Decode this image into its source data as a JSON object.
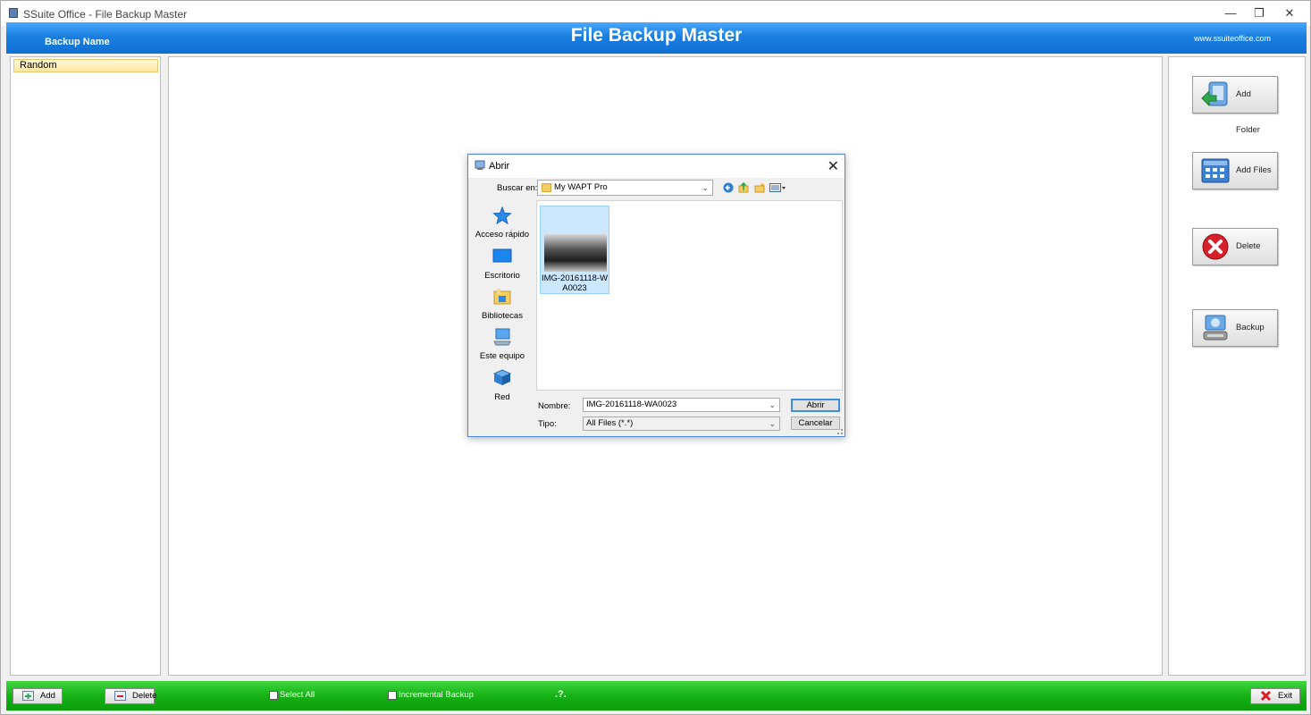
{
  "window": {
    "title": "SSuite Office - File Backup Master",
    "minimize_glyph": "—",
    "restore_glyph": "❐",
    "close_glyph": "✕"
  },
  "header": {
    "backup_name_label": "Backup Name",
    "app_title": "File Backup Master",
    "website": "www.ssuiteoffice.com",
    "color": "#1a7fe0"
  },
  "backup_list": {
    "items": [
      {
        "label": "Random",
        "selected": true
      }
    ]
  },
  "side_buttons": {
    "add_folder": {
      "label": "Add Folder",
      "icon": "add-folder-icon"
    },
    "add_files": {
      "label": "Add Files",
      "icon": "add-files-icon"
    },
    "delete": {
      "label": "Delete",
      "icon": "delete-icon"
    },
    "backup": {
      "label": "Backup",
      "icon": "backup-icon"
    }
  },
  "footer": {
    "color": "#15b215",
    "add_label": "Add",
    "delete_label": "Delete",
    "select_all_label": "Select All",
    "incremental_label": "Incremental Backup",
    "help_text": ".?.",
    "exit_label": "Exit"
  },
  "dialog": {
    "title": "Abrir",
    "close_glyph": "✕",
    "look_in_label": "Buscar en:",
    "look_in_value": "My WAPT Pro",
    "places": [
      {
        "label": "Acceso rápido",
        "icon": "star-icon"
      },
      {
        "label": "Escritorio",
        "icon": "desktop-icon"
      },
      {
        "label": "Bibliotecas",
        "icon": "libraries-icon"
      },
      {
        "label": "Este equipo",
        "icon": "computer-icon"
      },
      {
        "label": "Red",
        "icon": "network-icon"
      }
    ],
    "files": [
      {
        "name": "IMG-20161118-WA0023",
        "selected": true
      }
    ],
    "filename_label": "Nombre:",
    "filename_value": "IMG-20161118-WA0023",
    "filetype_label": "Tipo:",
    "filetype_value": "All Files (*.*)",
    "open_label": "Abrir",
    "cancel_label": "Cancelar"
  }
}
